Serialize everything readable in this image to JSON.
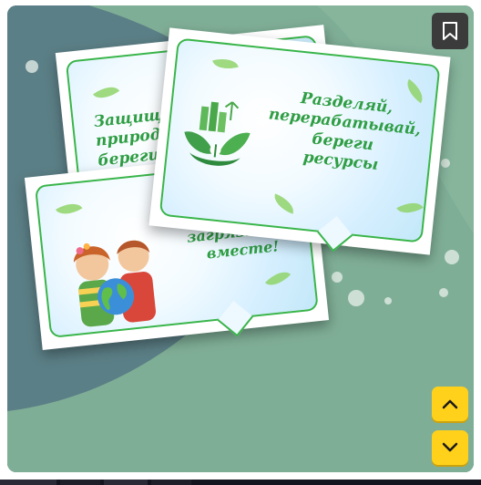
{
  "viewer": {
    "bookmark_icon": "bookmark-icon",
    "nav_up_icon": "chevron-up-icon",
    "nav_down_icon": "chevron-down-icon",
    "accent_color": "#ffd11a",
    "bookmark_bg": "#3b3b3b"
  },
  "background": {
    "base_color": "#5b7f86",
    "shape_color": "#7fae96"
  },
  "cards": {
    "back": {
      "text": "Защищай\nприроду,\nберегите\nеё\nбудущее"
    },
    "middle": {
      "text": "загрязнение\nвместе!"
    },
    "front": {
      "text": "Разделяй,\nперерабатывай,\nбереги\nресурсы"
    }
  }
}
